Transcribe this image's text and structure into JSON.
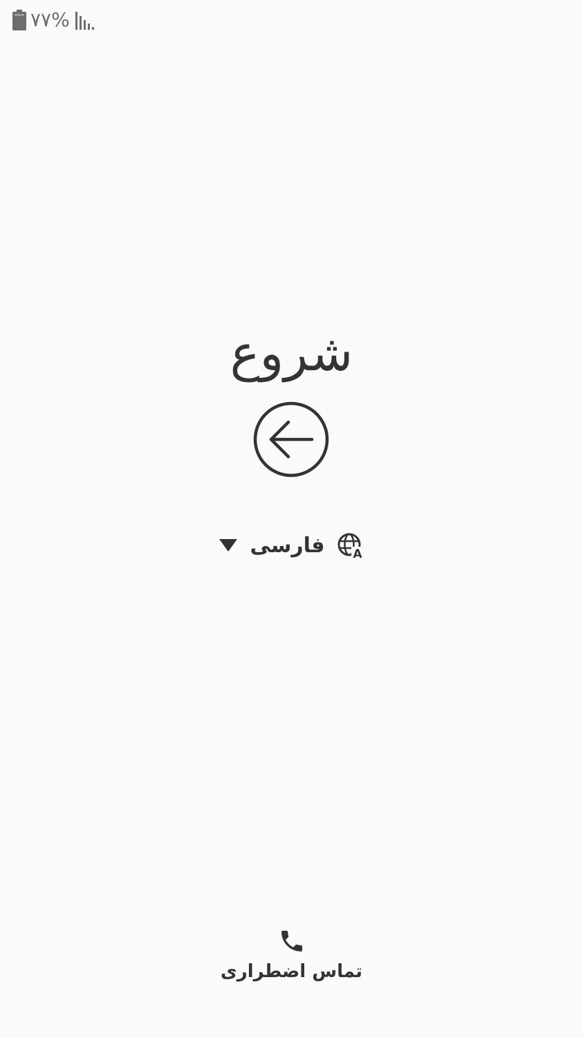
{
  "status_bar": {
    "battery_text": "۷۷%",
    "battery_icon": "battery-icon",
    "signal_icon": "signal-icon"
  },
  "title": "شروع",
  "start_button": {
    "icon": "arrow-left-circle-icon"
  },
  "language": {
    "selected": "فارسی",
    "icon": "globe-language-icon",
    "dropdown_icon": "triangle-down-icon"
  },
  "emergency": {
    "label": "تماس اضطراری",
    "icon": "phone-icon"
  },
  "colors": {
    "background": "#fafafa",
    "text": "#333333",
    "status": "#6d6d6d"
  }
}
